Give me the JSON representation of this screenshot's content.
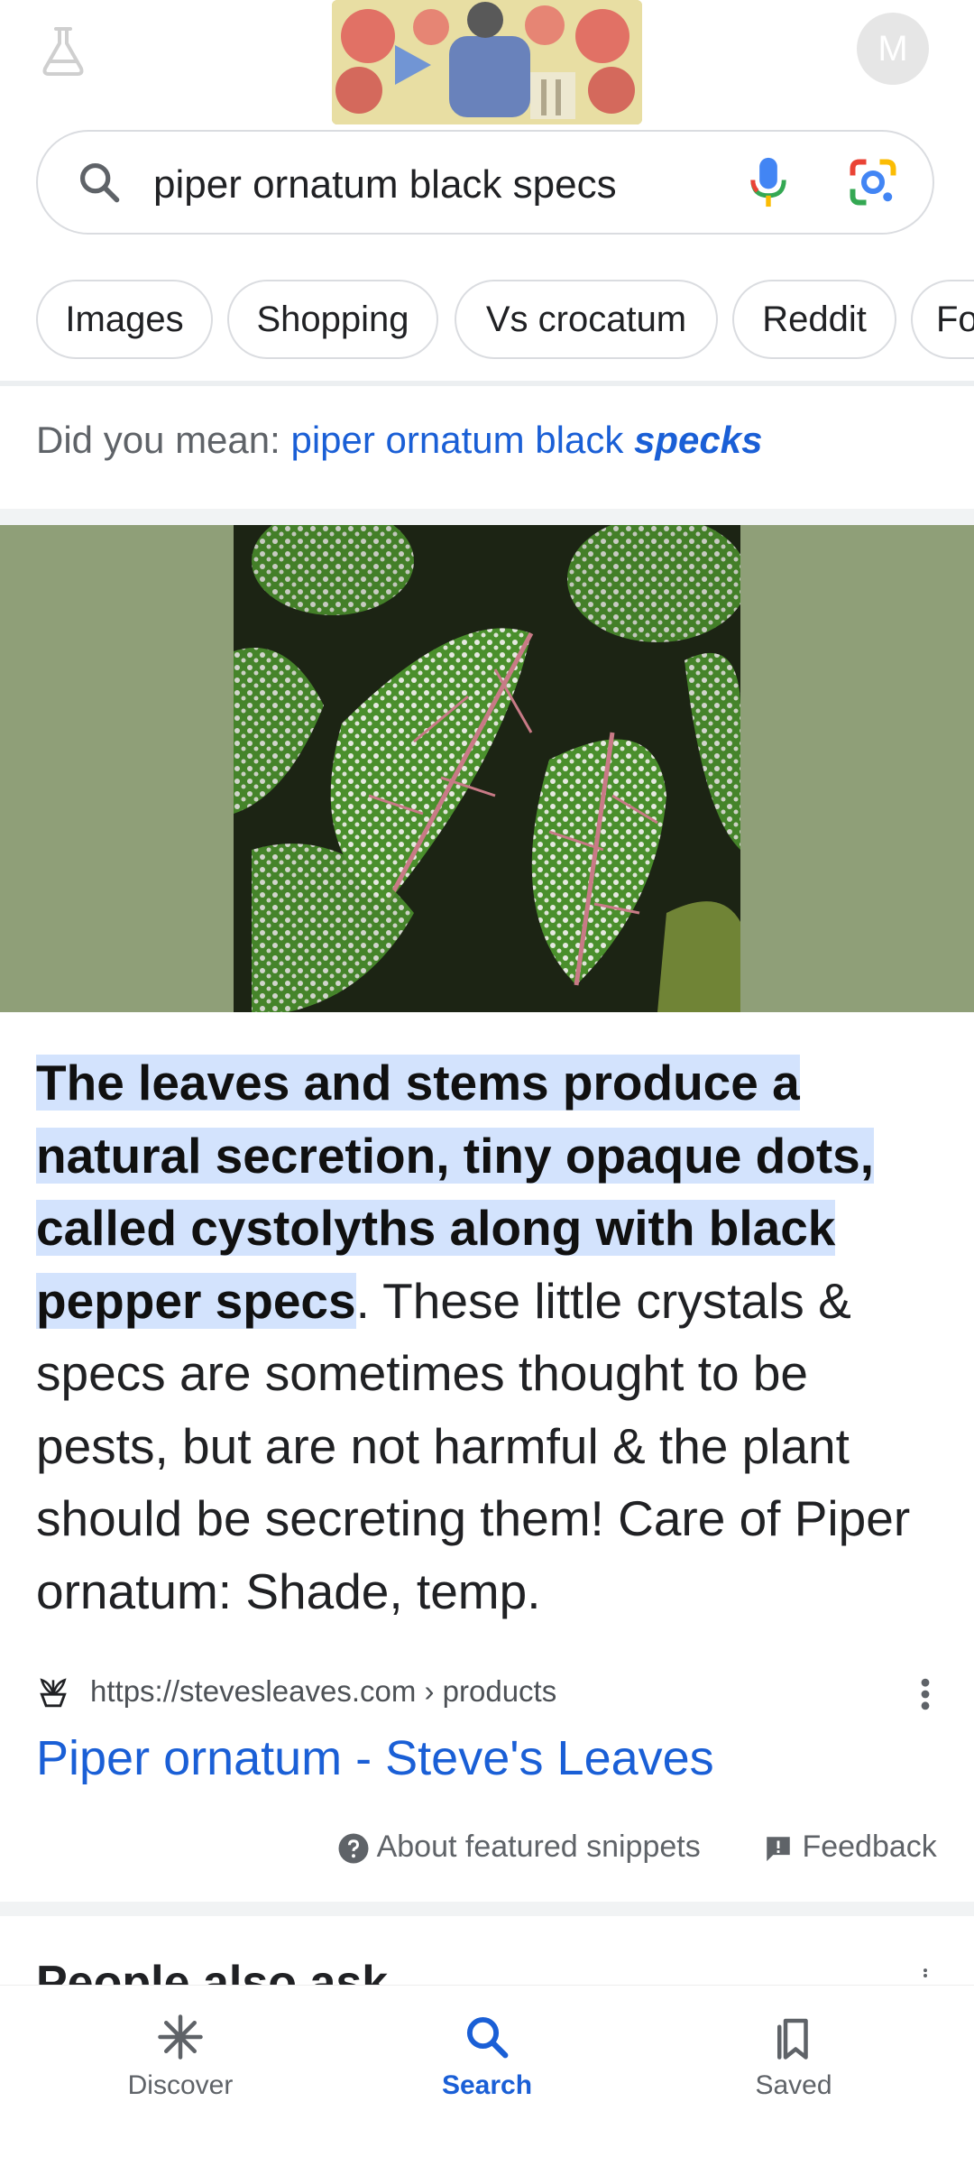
{
  "header": {
    "avatar_initial": "M",
    "icons": [
      "labs-flask-icon",
      "google-doodle",
      "avatar"
    ]
  },
  "search": {
    "query": "piper ornatum black specs",
    "icons": [
      "search-icon",
      "mic-icon",
      "lens-icon"
    ]
  },
  "chips": [
    {
      "label": "Images"
    },
    {
      "label": "Shopping"
    },
    {
      "label": "Vs crocatum"
    },
    {
      "label": "Reddit"
    },
    {
      "label": "Fo"
    }
  ],
  "did_you_mean": {
    "prefix": "Did you mean: ",
    "suggestion_plain": "piper ornatum black ",
    "suggestion_bold": "specks"
  },
  "featured_snippet": {
    "highlighted": "The leaves and stems produce a natural secretion, tiny opaque dots, called cystolyths along with black pepper specs",
    "rest": ". These little crystals & specs are sometimes thought to be pests, but are not harmful & the plant should be secreting them! Care of Piper ornatum: Shade, temp.",
    "source_url": "https://stevesleaves.com › products",
    "title": "Piper ornatum - Steve's Leaves",
    "about_label": "About featured snippets",
    "feedback_label": "Feedback"
  },
  "people_also_ask": {
    "heading": "People also ask"
  },
  "bottom_nav": {
    "items": [
      {
        "label": "Discover",
        "icon": "asterisk-icon"
      },
      {
        "label": "Search",
        "icon": "search-icon",
        "active": true
      },
      {
        "label": "Saved",
        "icon": "bookmarks-icon"
      }
    ]
  },
  "colors": {
    "link_blue": "#1a5fd6",
    "highlight": "#d3e3fd",
    "hero_bg": "#8f9f78"
  }
}
